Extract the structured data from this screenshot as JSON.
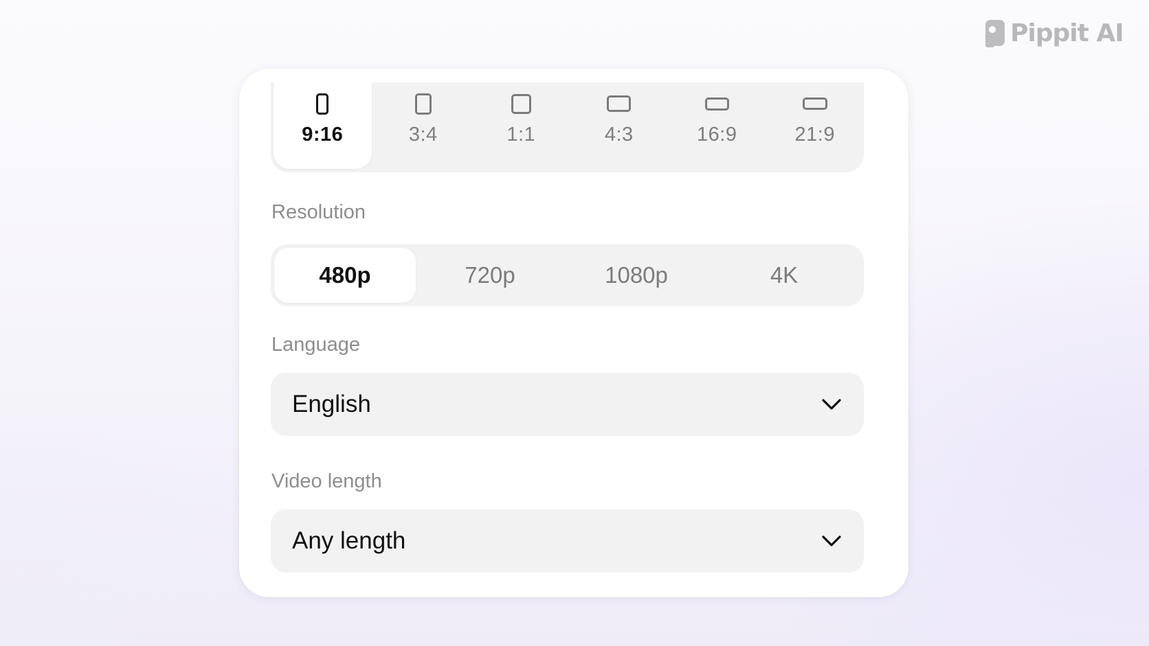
{
  "brand": {
    "name": "Pippit AI",
    "logo_icon": "pippit-logo-icon"
  },
  "aspect_ratio": {
    "selected": "9:16",
    "options": [
      {
        "label": "9:16",
        "icon": "portrait-9-16-icon"
      },
      {
        "label": "3:4",
        "icon": "portrait-3-4-icon"
      },
      {
        "label": "1:1",
        "icon": "square-1-1-icon"
      },
      {
        "label": "4:3",
        "icon": "landscape-4-3-icon"
      },
      {
        "label": "16:9",
        "icon": "landscape-16-9-icon"
      },
      {
        "label": "21:9",
        "icon": "landscape-21-9-icon"
      }
    ]
  },
  "resolution": {
    "label": "Resolution",
    "selected": "480p",
    "options": [
      "480p",
      "720p",
      "1080p",
      "4K"
    ]
  },
  "language": {
    "label": "Language",
    "value": "English",
    "icon": "chevron-down-icon"
  },
  "video_length": {
    "label": "Video length",
    "value": "Any length",
    "icon": "chevron-down-icon"
  },
  "colors": {
    "card_bg": "#ffffff",
    "control_bg": "#f2f2f2",
    "selected_text": "#111111",
    "unselected_text": "#7b7b7b",
    "label_text": "#8d8d8d",
    "brand_gray": "#b8b8bb"
  }
}
